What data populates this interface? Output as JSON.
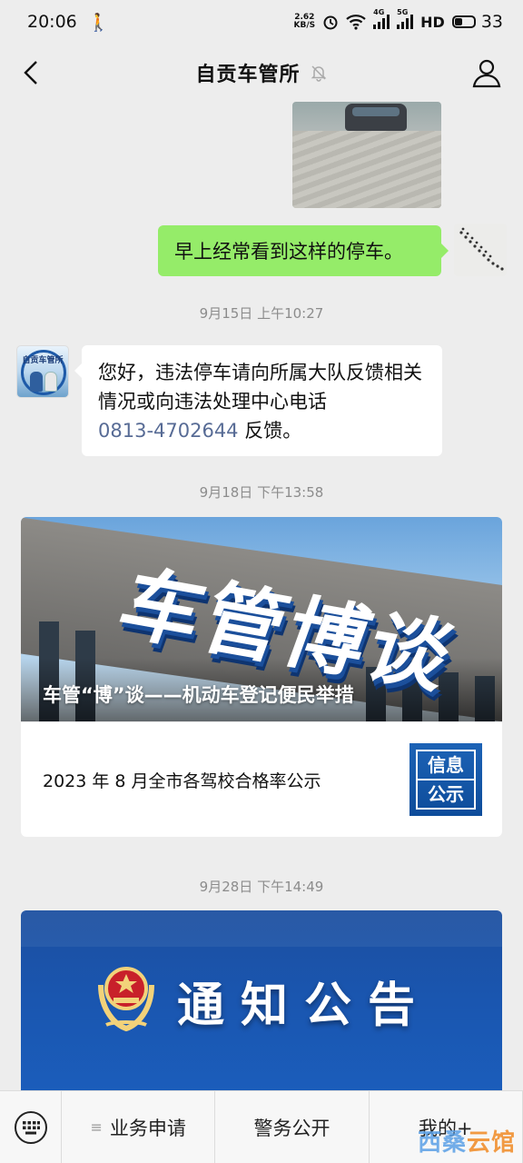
{
  "status_bar": {
    "time": "20:06",
    "net_speed_value": "2.62",
    "net_speed_unit": "KB/S",
    "sig1_label": "4G",
    "sig2_label": "5G",
    "hd_label": "HD",
    "battery": "33"
  },
  "header": {
    "title": "自贡车管所"
  },
  "messages": {
    "outgoing_text": "早上经常看到这样的停车。",
    "time1": "9月15日 上午10:27",
    "incoming_text": "您好，违法停车请向所属大队反馈相关情况或向违法处理中心电话",
    "incoming_phone": "0813-4702644",
    "incoming_suffix": " 反馈。",
    "avatar_label": "自贡车管所",
    "time2": "9月18日 下午13:58",
    "time3": "9月28日 下午14:49"
  },
  "article": {
    "cover_headline": "车管博谈",
    "cover_title": "车管“博”谈——机动车登记便民举措",
    "item_title": "2023 年 8 月全市各驾校合格率公示",
    "thumb_line1": "信息",
    "thumb_line2": "公示"
  },
  "notice": {
    "headline": "通知公告"
  },
  "bottom_menu": {
    "item1": "业务申请",
    "item2": "警务公开",
    "item3": "我的+"
  },
  "watermark": {
    "part1": "西桑",
    "part2": "云馆"
  },
  "colors": {
    "outgoing_bubble": "#95ec69",
    "link": "#576b95",
    "background": "#ededed"
  }
}
